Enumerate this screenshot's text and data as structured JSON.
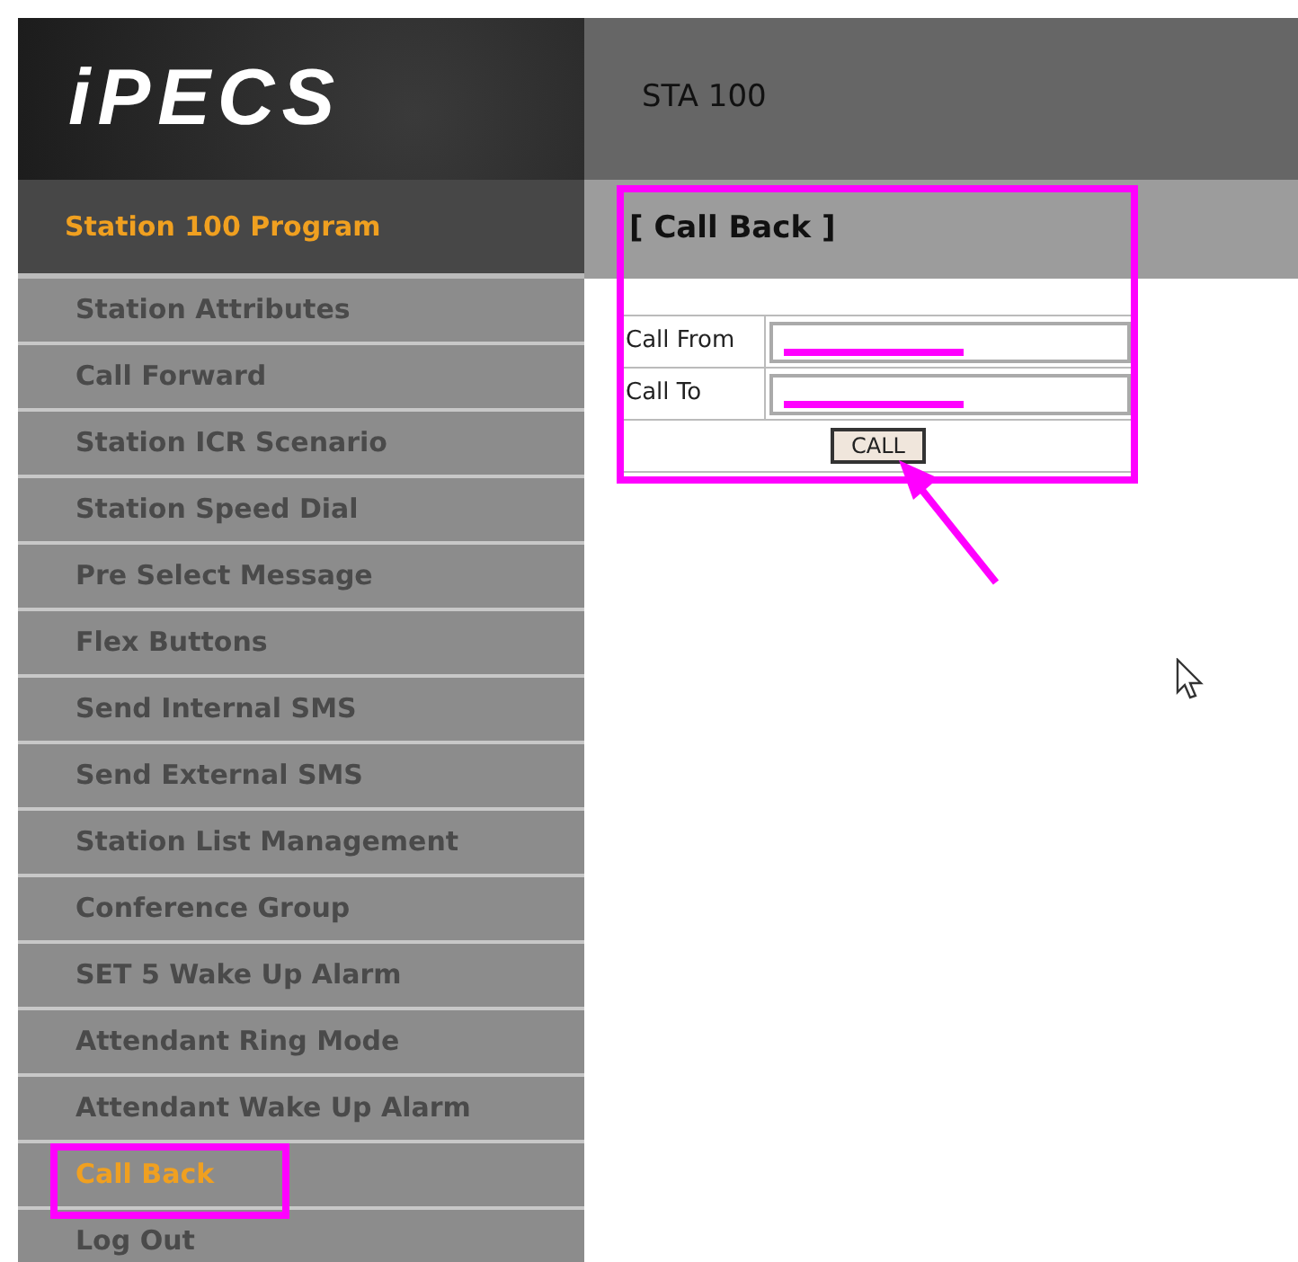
{
  "logo": {
    "text": "iPECS"
  },
  "header": {
    "title": "STA 100"
  },
  "sidebar": {
    "heading": "Station 100 Program",
    "items": [
      {
        "label": "Station Attributes",
        "selected": false
      },
      {
        "label": "Call Forward",
        "selected": false
      },
      {
        "label": "Station ICR Scenario",
        "selected": false
      },
      {
        "label": "Station Speed Dial",
        "selected": false
      },
      {
        "label": "Pre Select Message",
        "selected": false
      },
      {
        "label": "Flex Buttons",
        "selected": false
      },
      {
        "label": "Send Internal SMS",
        "selected": false
      },
      {
        "label": "Send External SMS",
        "selected": false
      },
      {
        "label": "Station List Management",
        "selected": false
      },
      {
        "label": "Conference Group",
        "selected": false
      },
      {
        "label": "SET 5 Wake Up Alarm",
        "selected": false
      },
      {
        "label": "Attendant Ring Mode",
        "selected": false
      },
      {
        "label": "Attendant Wake Up Alarm",
        "selected": false
      },
      {
        "label": "Call Back",
        "selected": true
      },
      {
        "label": "Log Out",
        "selected": false
      }
    ]
  },
  "panel": {
    "title": "[ Call Back ]",
    "fields": [
      {
        "label": "Call From"
      },
      {
        "label": "Call To"
      }
    ],
    "button": "CALL"
  }
}
